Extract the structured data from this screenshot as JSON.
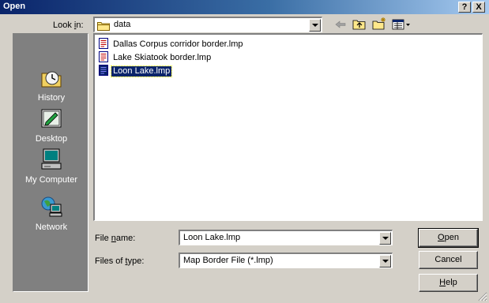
{
  "window": {
    "title": "Open",
    "help_label": "?",
    "close_label": "X"
  },
  "look_in": {
    "label": "Look in:",
    "label_pre": "Look ",
    "label_ul": "i",
    "label_post": "n:",
    "value": "data",
    "icon": "folder-icon"
  },
  "toolbar": {
    "back_icon": "back-arrow-icon",
    "up_icon": "up-one-level-icon",
    "new_folder_icon": "new-folder-icon",
    "views_icon": "views-menu-icon"
  },
  "places": [
    {
      "label": "History",
      "icon": "history-icon"
    },
    {
      "label": "Desktop",
      "icon": "desktop-icon"
    },
    {
      "label": "My Computer",
      "icon": "my-computer-icon"
    },
    {
      "label": "Network",
      "icon": "network-icon"
    }
  ],
  "files": [
    {
      "name": "Dallas Corpus corridor border.lmp",
      "selected": false
    },
    {
      "name": "Lake Skiatook border.lmp",
      "selected": false
    },
    {
      "name": "Loon Lake.lmp",
      "selected": true
    }
  ],
  "file_name": {
    "label": "File name:",
    "label_pre": "File ",
    "label_ul": "n",
    "label_post": "ame:",
    "value": "Loon Lake.lmp"
  },
  "file_type": {
    "label": "Files of type:",
    "label_pre": "Files of ",
    "label_ul": "t",
    "label_post": "ype:",
    "value": "Map Border File (*.lmp)"
  },
  "buttons": {
    "open": "Open",
    "open_ul": "O",
    "open_rest": "pen",
    "cancel": "Cancel",
    "help": "Help",
    "help_ul": "H",
    "help_rest": "elp"
  }
}
